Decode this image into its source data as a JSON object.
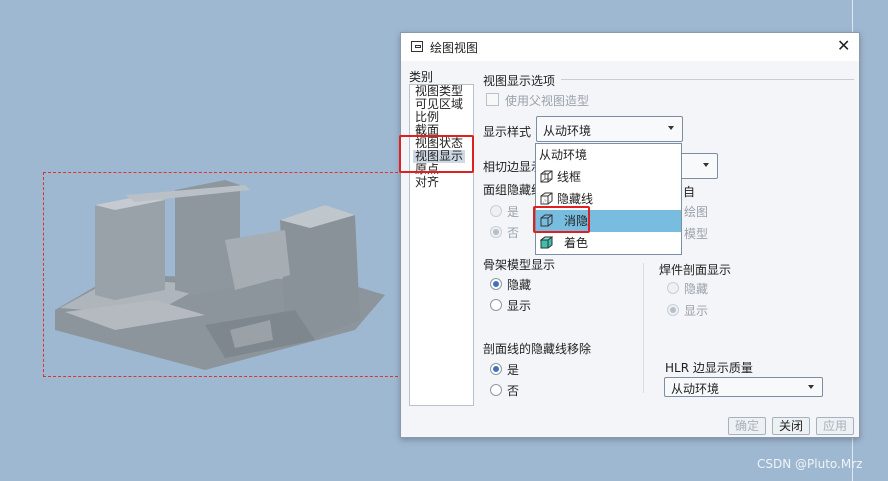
{
  "dialog": {
    "title": "绘图视图",
    "close_label": "✕",
    "category_label": "类别",
    "categories": [
      "视图类型",
      "可见区域",
      "比例",
      "截面",
      "视图状态",
      "视图显示",
      "原点",
      "对齐"
    ],
    "section_title": "视图显示选项",
    "use_parent_label": "使用父视图造型",
    "display_style_label": "显示样式",
    "display_style_value": "从动环境",
    "tangent_label": "相切边显示",
    "surface_hidden_label": "面组隐藏线",
    "yes": "是",
    "no": "否",
    "from_label": "自",
    "drawing_label": "绘图",
    "model_label": "模型",
    "skeleton_label": "骨架模型显示",
    "hide_label": "隐藏",
    "show_label": "显示",
    "weld_label": "焊件剖面显示",
    "section_line_label": "剖面线的隐藏线移除",
    "hlr_label": "HLR 边显示质量",
    "hlr_value": "从动环境",
    "buttons": {
      "ok": "确定",
      "close": "关闭",
      "apply": "应用"
    }
  },
  "dropdown": {
    "items": [
      "从动环境",
      "线框",
      "隐藏线",
      "消隐",
      "着色"
    ],
    "highlighted": "消隐"
  },
  "watermark": "CSDN @Pluto.Mrz",
  "colors": {
    "background": "#9fb8d2",
    "highlight": "#78bde0",
    "annotation_red": "#e02020"
  }
}
